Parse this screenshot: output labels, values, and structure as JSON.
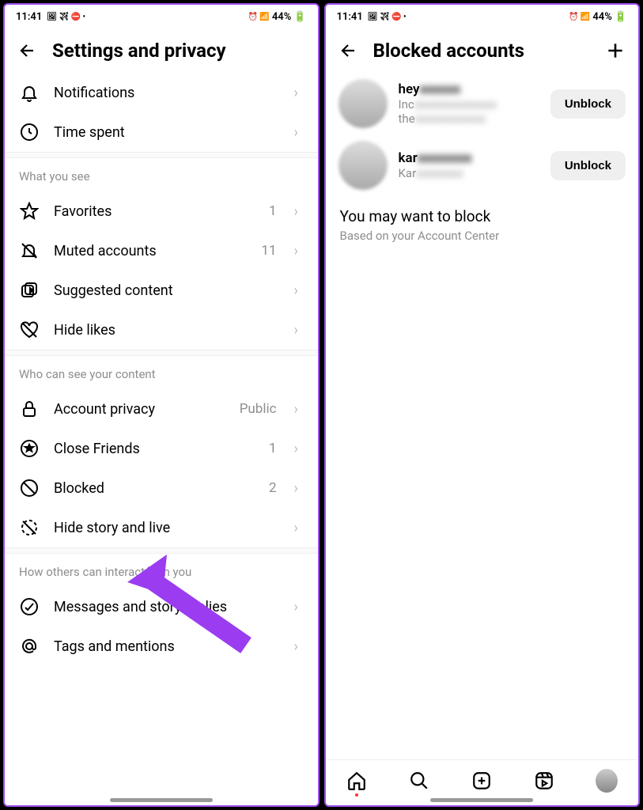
{
  "status": {
    "time": "11:41",
    "battery": "44%"
  },
  "left": {
    "title": "Settings and privacy",
    "top_rows": [
      {
        "icon": "bell",
        "label": "Notifications",
        "value": ""
      },
      {
        "icon": "clock",
        "label": "Time spent",
        "value": ""
      }
    ],
    "sections": [
      {
        "header": "What you see",
        "rows": [
          {
            "icon": "star",
            "label": "Favorites",
            "value": "1"
          },
          {
            "icon": "bell-off",
            "label": "Muted accounts",
            "value": "11"
          },
          {
            "icon": "play-circle",
            "label": "Suggested content",
            "value": ""
          },
          {
            "icon": "heart-off",
            "label": "Hide likes",
            "value": ""
          }
        ]
      },
      {
        "header": "Who can see your content",
        "rows": [
          {
            "icon": "lock",
            "label": "Account privacy",
            "value": "Public"
          },
          {
            "icon": "star-circle",
            "label": "Close Friends",
            "value": "1"
          },
          {
            "icon": "block",
            "label": "Blocked",
            "value": "2"
          },
          {
            "icon": "story-off",
            "label": "Hide story and live",
            "value": ""
          }
        ]
      },
      {
        "header": "How others can interact with you",
        "rows": [
          {
            "icon": "message",
            "label": "Messages and story replies",
            "value": ""
          },
          {
            "icon": "at",
            "label": "Tags and mentions",
            "value": ""
          }
        ]
      }
    ]
  },
  "right": {
    "title": "Blocked accounts",
    "blocked": [
      {
        "name": "hey",
        "sub_line1": "Inc",
        "sub_line2": "the",
        "btn": "Unblock"
      },
      {
        "name": "kar",
        "sub_line1": "Kar",
        "btn": "Unblock"
      }
    ],
    "suggest": {
      "title": "You may want to block",
      "sub": "Based on your Account Center"
    }
  },
  "arrow_color": "#9b3cf0"
}
